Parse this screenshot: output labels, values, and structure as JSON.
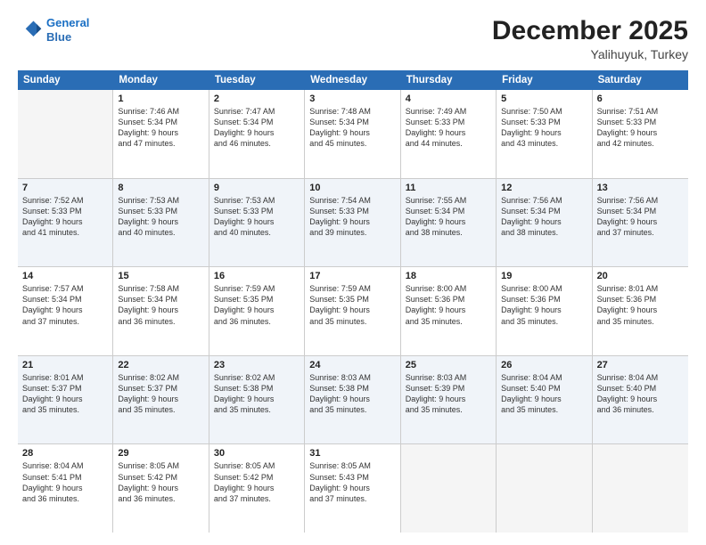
{
  "header": {
    "logo_line1": "General",
    "logo_line2": "Blue",
    "month": "December 2025",
    "location": "Yalihuyuk, Turkey"
  },
  "days_of_week": [
    "Sunday",
    "Monday",
    "Tuesday",
    "Wednesday",
    "Thursday",
    "Friday",
    "Saturday"
  ],
  "weeks": [
    [
      {
        "day": "",
        "info": [],
        "empty": true
      },
      {
        "day": "1",
        "info": [
          "Sunrise: 7:46 AM",
          "Sunset: 5:34 PM",
          "Daylight: 9 hours",
          "and 47 minutes."
        ]
      },
      {
        "day": "2",
        "info": [
          "Sunrise: 7:47 AM",
          "Sunset: 5:34 PM",
          "Daylight: 9 hours",
          "and 46 minutes."
        ]
      },
      {
        "day": "3",
        "info": [
          "Sunrise: 7:48 AM",
          "Sunset: 5:34 PM",
          "Daylight: 9 hours",
          "and 45 minutes."
        ]
      },
      {
        "day": "4",
        "info": [
          "Sunrise: 7:49 AM",
          "Sunset: 5:33 PM",
          "Daylight: 9 hours",
          "and 44 minutes."
        ]
      },
      {
        "day": "5",
        "info": [
          "Sunrise: 7:50 AM",
          "Sunset: 5:33 PM",
          "Daylight: 9 hours",
          "and 43 minutes."
        ]
      },
      {
        "day": "6",
        "info": [
          "Sunrise: 7:51 AM",
          "Sunset: 5:33 PM",
          "Daylight: 9 hours",
          "and 42 minutes."
        ]
      }
    ],
    [
      {
        "day": "7",
        "info": [
          "Sunrise: 7:52 AM",
          "Sunset: 5:33 PM",
          "Daylight: 9 hours",
          "and 41 minutes."
        ]
      },
      {
        "day": "8",
        "info": [
          "Sunrise: 7:53 AM",
          "Sunset: 5:33 PM",
          "Daylight: 9 hours",
          "and 40 minutes."
        ]
      },
      {
        "day": "9",
        "info": [
          "Sunrise: 7:53 AM",
          "Sunset: 5:33 PM",
          "Daylight: 9 hours",
          "and 40 minutes."
        ]
      },
      {
        "day": "10",
        "info": [
          "Sunrise: 7:54 AM",
          "Sunset: 5:33 PM",
          "Daylight: 9 hours",
          "and 39 minutes."
        ]
      },
      {
        "day": "11",
        "info": [
          "Sunrise: 7:55 AM",
          "Sunset: 5:34 PM",
          "Daylight: 9 hours",
          "and 38 minutes."
        ]
      },
      {
        "day": "12",
        "info": [
          "Sunrise: 7:56 AM",
          "Sunset: 5:34 PM",
          "Daylight: 9 hours",
          "and 38 minutes."
        ]
      },
      {
        "day": "13",
        "info": [
          "Sunrise: 7:56 AM",
          "Sunset: 5:34 PM",
          "Daylight: 9 hours",
          "and 37 minutes."
        ]
      }
    ],
    [
      {
        "day": "14",
        "info": [
          "Sunrise: 7:57 AM",
          "Sunset: 5:34 PM",
          "Daylight: 9 hours",
          "and 37 minutes."
        ]
      },
      {
        "day": "15",
        "info": [
          "Sunrise: 7:58 AM",
          "Sunset: 5:34 PM",
          "Daylight: 9 hours",
          "and 36 minutes."
        ]
      },
      {
        "day": "16",
        "info": [
          "Sunrise: 7:59 AM",
          "Sunset: 5:35 PM",
          "Daylight: 9 hours",
          "and 36 minutes."
        ]
      },
      {
        "day": "17",
        "info": [
          "Sunrise: 7:59 AM",
          "Sunset: 5:35 PM",
          "Daylight: 9 hours",
          "and 35 minutes."
        ]
      },
      {
        "day": "18",
        "info": [
          "Sunrise: 8:00 AM",
          "Sunset: 5:36 PM",
          "Daylight: 9 hours",
          "and 35 minutes."
        ]
      },
      {
        "day": "19",
        "info": [
          "Sunrise: 8:00 AM",
          "Sunset: 5:36 PM",
          "Daylight: 9 hours",
          "and 35 minutes."
        ]
      },
      {
        "day": "20",
        "info": [
          "Sunrise: 8:01 AM",
          "Sunset: 5:36 PM",
          "Daylight: 9 hours",
          "and 35 minutes."
        ]
      }
    ],
    [
      {
        "day": "21",
        "info": [
          "Sunrise: 8:01 AM",
          "Sunset: 5:37 PM",
          "Daylight: 9 hours",
          "and 35 minutes."
        ]
      },
      {
        "day": "22",
        "info": [
          "Sunrise: 8:02 AM",
          "Sunset: 5:37 PM",
          "Daylight: 9 hours",
          "and 35 minutes."
        ]
      },
      {
        "day": "23",
        "info": [
          "Sunrise: 8:02 AM",
          "Sunset: 5:38 PM",
          "Daylight: 9 hours",
          "and 35 minutes."
        ]
      },
      {
        "day": "24",
        "info": [
          "Sunrise: 8:03 AM",
          "Sunset: 5:38 PM",
          "Daylight: 9 hours",
          "and 35 minutes."
        ]
      },
      {
        "day": "25",
        "info": [
          "Sunrise: 8:03 AM",
          "Sunset: 5:39 PM",
          "Daylight: 9 hours",
          "and 35 minutes."
        ]
      },
      {
        "day": "26",
        "info": [
          "Sunrise: 8:04 AM",
          "Sunset: 5:40 PM",
          "Daylight: 9 hours",
          "and 35 minutes."
        ]
      },
      {
        "day": "27",
        "info": [
          "Sunrise: 8:04 AM",
          "Sunset: 5:40 PM",
          "Daylight: 9 hours",
          "and 36 minutes."
        ]
      }
    ],
    [
      {
        "day": "28",
        "info": [
          "Sunrise: 8:04 AM",
          "Sunset: 5:41 PM",
          "Daylight: 9 hours",
          "and 36 minutes."
        ]
      },
      {
        "day": "29",
        "info": [
          "Sunrise: 8:05 AM",
          "Sunset: 5:42 PM",
          "Daylight: 9 hours",
          "and 36 minutes."
        ]
      },
      {
        "day": "30",
        "info": [
          "Sunrise: 8:05 AM",
          "Sunset: 5:42 PM",
          "Daylight: 9 hours",
          "and 37 minutes."
        ]
      },
      {
        "day": "31",
        "info": [
          "Sunrise: 8:05 AM",
          "Sunset: 5:43 PM",
          "Daylight: 9 hours",
          "and 37 minutes."
        ]
      },
      {
        "day": "",
        "info": [],
        "empty": true
      },
      {
        "day": "",
        "info": [],
        "empty": true
      },
      {
        "day": "",
        "info": [],
        "empty": true
      }
    ]
  ]
}
